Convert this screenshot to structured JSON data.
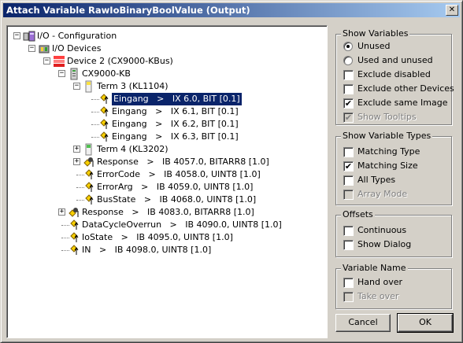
{
  "window": {
    "title": "Attach Variable RawIoBinaryBoolValue (Output)",
    "close_glyph": "✕"
  },
  "tree": [
    {
      "label": "I/O - Configuration",
      "icon": "io-config-icon",
      "expander": "−"
    },
    {
      "label": "I/O Devices",
      "icon": "io-devices-icon",
      "expander": "−"
    },
    {
      "label": "Device 2 (CX9000-KBus)",
      "icon": "device-icon",
      "expander": "−"
    },
    {
      "label": "CX9000-KB",
      "icon": "cx-coupler-icon",
      "expander": "−"
    },
    {
      "label": "Term 3 (KL1104)",
      "icon": "terminal-yellow-icon",
      "expander": "−"
    },
    {
      "label": "Eingang   >   IX 6.0, BIT [0.1]",
      "icon": "variable-icon",
      "selected": true
    },
    {
      "label": "Eingang   >   IX 6.1, BIT [0.1]",
      "icon": "variable-icon"
    },
    {
      "label": "Eingang   >   IX 6.2, BIT [0.1]",
      "icon": "variable-icon"
    },
    {
      "label": "Eingang   >   IX 6.3, BIT [0.1]",
      "icon": "variable-icon"
    },
    {
      "label": "Term 4 (KL3202)",
      "icon": "terminal-green-icon",
      "expander": "+"
    },
    {
      "label": "Response   >   IB 4057.0, BITARR8 [1.0]",
      "icon": "variable-struct-icon",
      "expander": "+"
    },
    {
      "label": "ErrorCode   >   IB 4058.0, UINT8 [1.0]",
      "icon": "variable-icon"
    },
    {
      "label": "ErrorArg   >   IB 4059.0, UINT8 [1.0]",
      "icon": "variable-icon"
    },
    {
      "label": "BusState   >   IB 4068.0, UINT8 [1.0]",
      "icon": "variable-icon"
    },
    {
      "label": "Response   >   IB 4083.0, BITARR8 [1.0]",
      "icon": "variable-struct-icon",
      "expander": "+"
    },
    {
      "label": "DataCycleOverrun   >   IB 4090.0, UINT8 [1.0]",
      "icon": "variable-icon"
    },
    {
      "label": "IoState   >   IB 4095.0, UINT8 [1.0]",
      "icon": "variable-icon"
    },
    {
      "label": "IN   >   IB 4098.0, UINT8 [1.0]",
      "icon": "variable-icon"
    }
  ],
  "show_variables": {
    "title": "Show Variables",
    "options": [
      {
        "label": "Unused",
        "type": "radio",
        "checked": true
      },
      {
        "label": "Used and unused",
        "type": "radio",
        "checked": false
      },
      {
        "label": "Exclude disabled",
        "type": "checkbox",
        "checked": false
      },
      {
        "label": "Exclude other Devices",
        "type": "checkbox",
        "checked": false
      },
      {
        "label": "Exclude same Image",
        "type": "checkbox",
        "checked": true
      },
      {
        "label": "Show Tooltips",
        "type": "checkbox",
        "checked": true,
        "disabled": true
      }
    ]
  },
  "show_variable_types": {
    "title": "Show Variable Types",
    "options": [
      {
        "label": "Matching Type",
        "checked": false
      },
      {
        "label": "Matching Size",
        "checked": true
      },
      {
        "label": "All Types",
        "checked": false
      },
      {
        "label": "Array Mode",
        "checked": false,
        "disabled": true
      }
    ]
  },
  "offsets": {
    "title": "Offsets",
    "options": [
      {
        "label": "Continuous",
        "checked": false
      },
      {
        "label": "Show Dialog",
        "checked": false
      }
    ]
  },
  "variable_name": {
    "title": "Variable Name",
    "options": [
      {
        "label": "Hand over",
        "checked": false
      },
      {
        "label": "Take over",
        "checked": false,
        "disabled": true
      }
    ]
  },
  "buttons": {
    "cancel": "Cancel",
    "ok": "OK"
  },
  "check_glyph": "✔"
}
